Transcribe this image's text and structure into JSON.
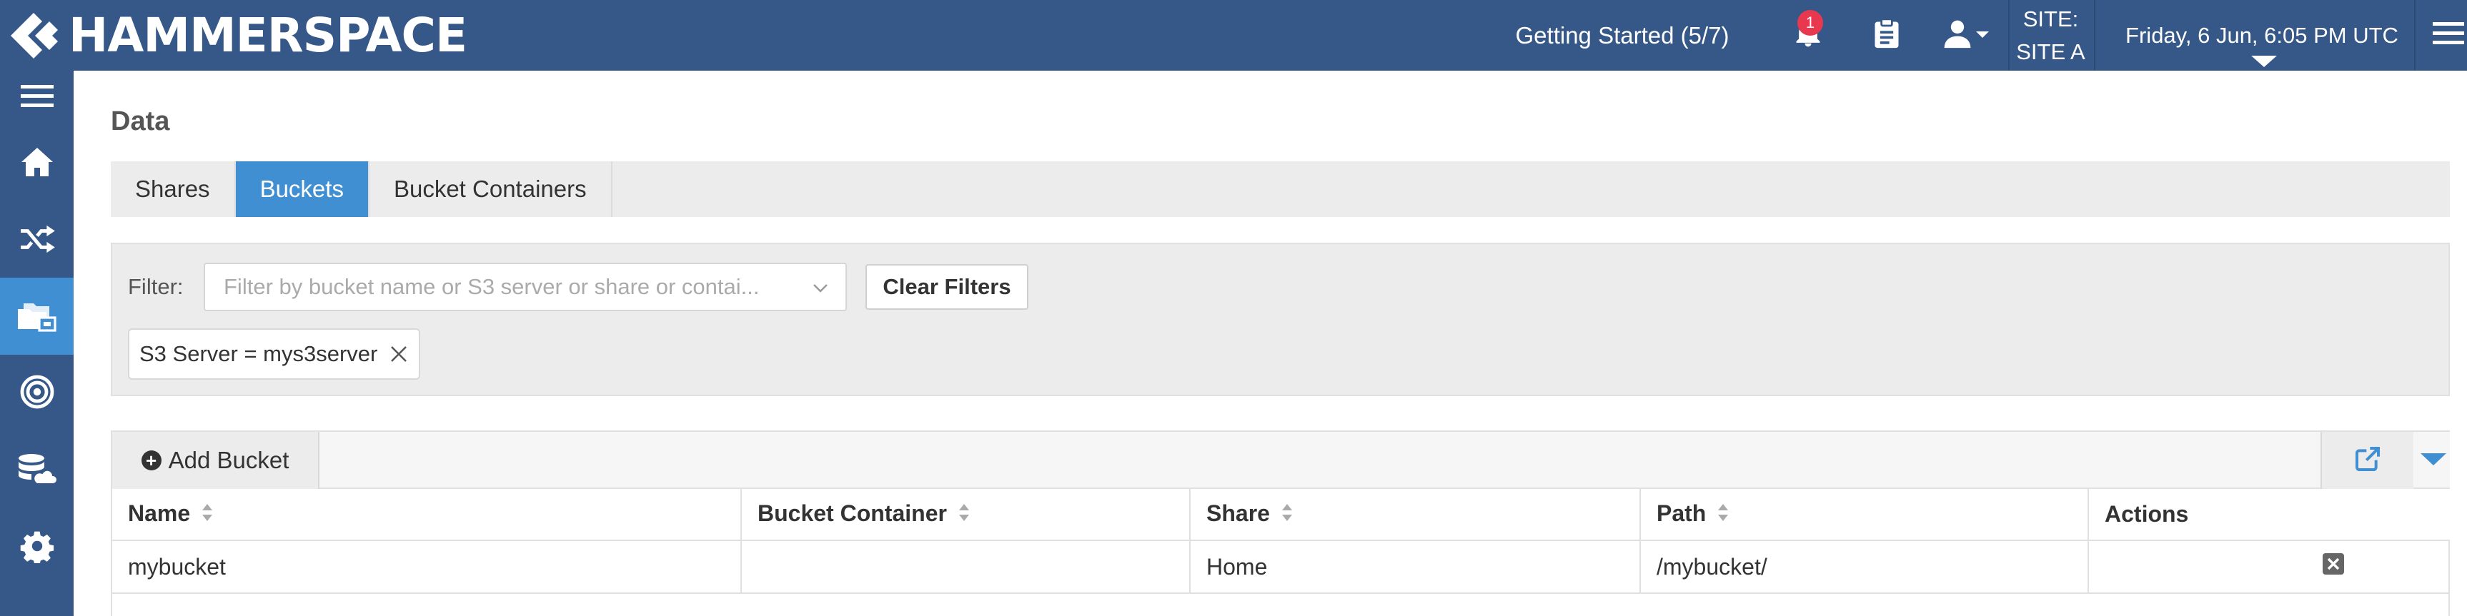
{
  "app": {
    "logo_text": "HAMMERSPACE"
  },
  "topbar": {
    "getting_started": "Getting Started (5/7)",
    "notification_count": "1",
    "site_label": "SITE:",
    "site_value": "SITE A",
    "datetime": "Friday, 6 Jun, 6:05 PM UTC"
  },
  "sidebar": {
    "items": [
      {
        "icon": "hamburger-icon",
        "active": false
      },
      {
        "icon": "home-icon",
        "active": false
      },
      {
        "icon": "shuffle-icon",
        "active": false
      },
      {
        "icon": "data-folders-icon",
        "active": true
      },
      {
        "icon": "target-icon",
        "active": false
      },
      {
        "icon": "storage-cloud-icon",
        "active": false
      },
      {
        "icon": "gear-icon",
        "active": false
      }
    ]
  },
  "page": {
    "title": "Data"
  },
  "tabs": [
    {
      "label": "Shares",
      "active": false
    },
    {
      "label": "Buckets",
      "active": true
    },
    {
      "label": "Bucket Containers",
      "active": false
    }
  ],
  "filter": {
    "label": "Filter:",
    "placeholder": "Filter by bucket name or S3 server or share or contai...",
    "clear_label": "Clear Filters",
    "chips": [
      {
        "label": "S3 Server = mys3server"
      }
    ]
  },
  "table": {
    "add_label": "Add Bucket",
    "columns": [
      "Name",
      "Bucket Container",
      "Share",
      "Path",
      "Actions"
    ],
    "rows": [
      {
        "name": "mybucket",
        "bucket_container": "",
        "share": "Home",
        "path": "/mybucket/"
      }
    ]
  },
  "colors": {
    "header_bg": "#365888",
    "accent": "#3f8fd2",
    "badge": "#e8384f"
  }
}
